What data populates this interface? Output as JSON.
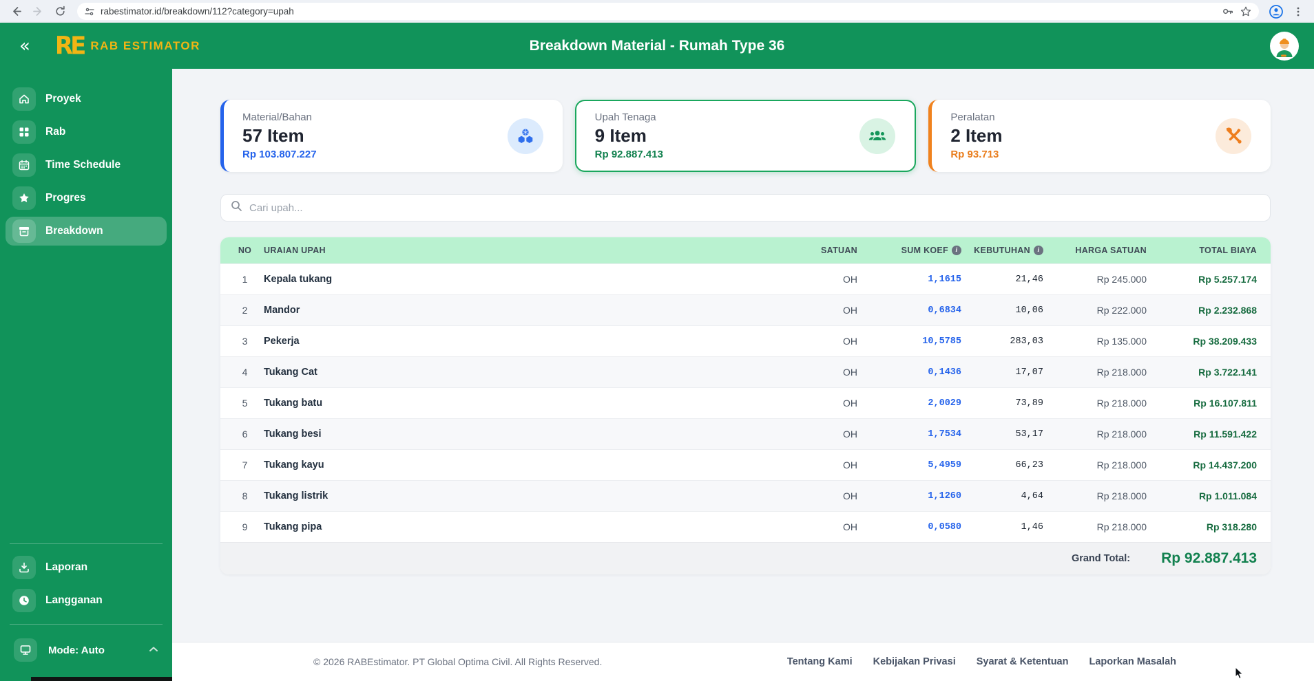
{
  "browser": {
    "url": "rabestimator.id/breakdown/112?category=upah"
  },
  "app_header": {
    "logo_text": "RE",
    "brand": "RAB ESTIMATOR",
    "title": "Breakdown Material - Rumah Type 36"
  },
  "sidebar": {
    "items": [
      {
        "label": "Proyek",
        "icon": "home-icon",
        "active": false
      },
      {
        "label": "Rab",
        "icon": "grid-icon",
        "active": false
      },
      {
        "label": "Time Schedule",
        "icon": "calendar-icon",
        "active": false
      },
      {
        "label": "Progres",
        "icon": "star-icon",
        "active": false
      },
      {
        "label": "Breakdown",
        "icon": "archive-icon",
        "active": true
      }
    ],
    "bottom_items": [
      {
        "label": "Laporan",
        "icon": "download-icon"
      },
      {
        "label": "Langganan",
        "icon": "clock-icon"
      }
    ],
    "mode_label": "Mode: Auto"
  },
  "cards": [
    {
      "label": "Material/Bahan",
      "count": "57 Item",
      "amount": "Rp 103.807.227",
      "accent": "#2563eb",
      "icon": "cubes-icon",
      "active": false
    },
    {
      "label": "Upah Tenaga",
      "count": "9 Item",
      "amount": "Rp 92.887.413",
      "accent": "#12814f",
      "icon": "people-icon",
      "active": true
    },
    {
      "label": "Peralatan",
      "count": "2 Item",
      "amount": "Rp 93.713",
      "accent": "#e97d1c",
      "icon": "tools-icon",
      "active": false
    }
  ],
  "search": {
    "placeholder": "Cari upah..."
  },
  "table": {
    "columns": [
      "NO",
      "URAIAN UPAH",
      "SATUAN",
      "SUM KOEF",
      "KEBUTUHAN",
      "HARGA SATUAN",
      "TOTAL BIAYA"
    ],
    "rows": [
      {
        "no": "1",
        "name": "Kepala tukang",
        "unit": "OH",
        "koef": "1,1615",
        "kebutuhan": "21,46",
        "harga": "Rp 245.000",
        "total": "Rp 5.257.174"
      },
      {
        "no": "2",
        "name": "Mandor",
        "unit": "OH",
        "koef": "0,6834",
        "kebutuhan": "10,06",
        "harga": "Rp 222.000",
        "total": "Rp 2.232.868"
      },
      {
        "no": "3",
        "name": "Pekerja",
        "unit": "OH",
        "koef": "10,5785",
        "kebutuhan": "283,03",
        "harga": "Rp 135.000",
        "total": "Rp 38.209.433"
      },
      {
        "no": "4",
        "name": "Tukang Cat",
        "unit": "OH",
        "koef": "0,1436",
        "kebutuhan": "17,07",
        "harga": "Rp 218.000",
        "total": "Rp 3.722.141"
      },
      {
        "no": "5",
        "name": "Tukang batu",
        "unit": "OH",
        "koef": "2,0029",
        "kebutuhan": "73,89",
        "harga": "Rp 218.000",
        "total": "Rp 16.107.811"
      },
      {
        "no": "6",
        "name": "Tukang besi",
        "unit": "OH",
        "koef": "1,7534",
        "kebutuhan": "53,17",
        "harga": "Rp 218.000",
        "total": "Rp 11.591.422"
      },
      {
        "no": "7",
        "name": "Tukang kayu",
        "unit": "OH",
        "koef": "5,4959",
        "kebutuhan": "66,23",
        "harga": "Rp 218.000",
        "total": "Rp 14.437.200"
      },
      {
        "no": "8",
        "name": "Tukang listrik",
        "unit": "OH",
        "koef": "1,1260",
        "kebutuhan": "4,64",
        "harga": "Rp 218.000",
        "total": "Rp 1.011.084"
      },
      {
        "no": "9",
        "name": "Tukang pipa",
        "unit": "OH",
        "koef": "0,0580",
        "kebutuhan": "1,46",
        "harga": "Rp 218.000",
        "total": "Rp 318.280"
      }
    ],
    "grand_total_label": "Grand Total:",
    "grand_total": "Rp 92.887.413"
  },
  "footer": {
    "copyright": "© 2026 RABEstimator. PT Global Optima Civil. All Rights Reserved.",
    "links": [
      "Tentang Kami",
      "Kebijakan Privasi",
      "Syarat & Ketentuan",
      "Laporkan Masalah"
    ]
  },
  "colors": {
    "header_green": "#11935a",
    "table_header_mint": "#b9f2d0",
    "accent_blue": "#2563eb",
    "accent_green": "#1aa75d",
    "accent_orange": "#f0821e",
    "total_green": "#166b3f"
  }
}
